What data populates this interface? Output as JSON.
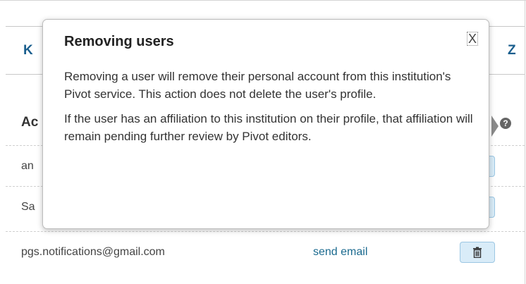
{
  "letters": {
    "first": "K",
    "last": "Z"
  },
  "column_header": "Ac",
  "help_icon_glyph": "?",
  "rows": [
    {
      "email": "an",
      "action": ""
    },
    {
      "email": "Sa",
      "action": ""
    },
    {
      "email": "pgs.notifications@gmail.com",
      "action": "send email"
    }
  ],
  "popover": {
    "title": "Removing users",
    "close": "X",
    "paragraph1": "Removing a user will remove their personal account from this institution's Pivot service. This action does not delete the user's profile.",
    "paragraph2": "If the user has an affiliation to this institution on their profile, that affiliation will remain pending further review by Pivot editors."
  },
  "colors": {
    "link": "#1b6a8f",
    "button_bg": "#d9ecf8",
    "button_border": "#9cc7e3"
  }
}
